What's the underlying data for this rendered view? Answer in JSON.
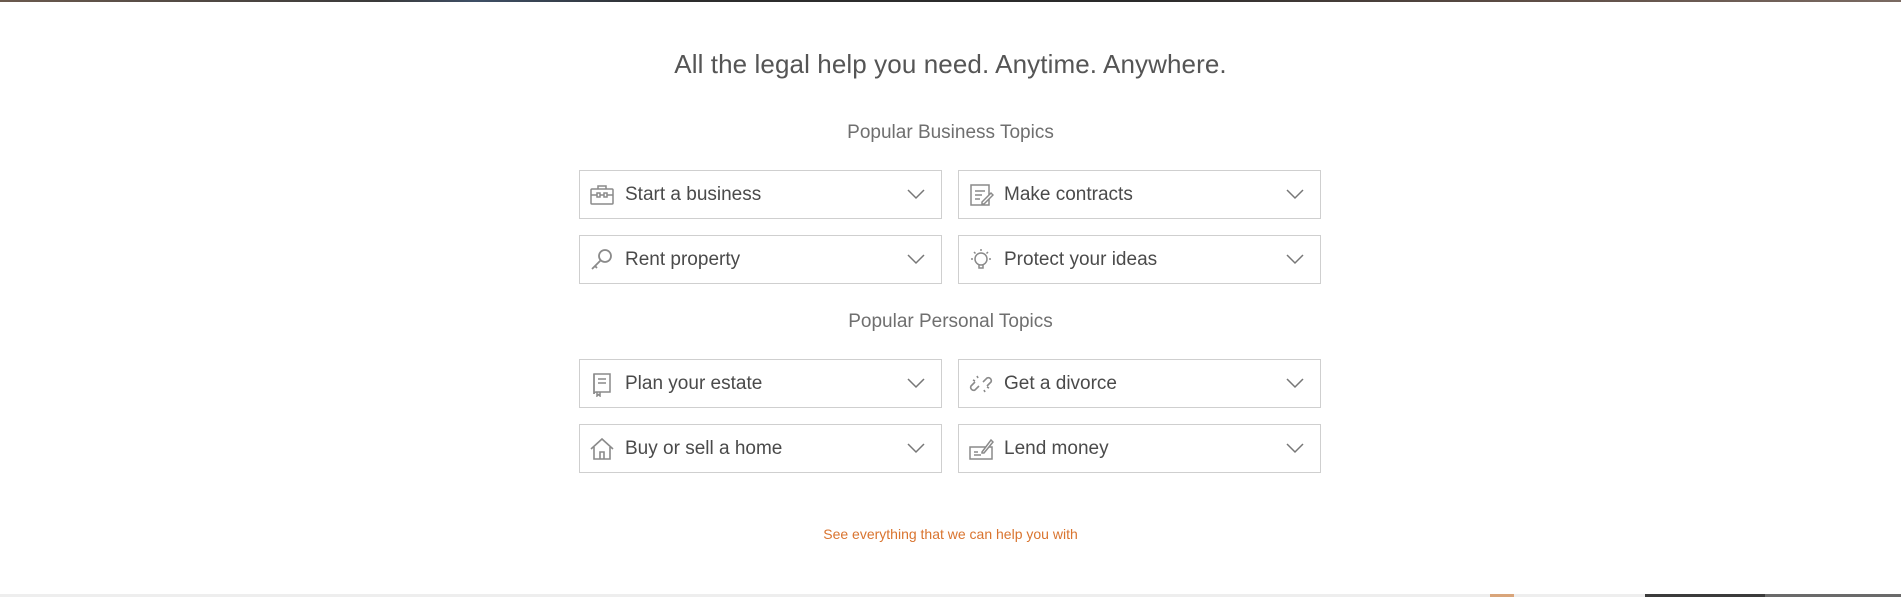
{
  "headline": "All the legal help you need. Anytime. Anywhere.",
  "business": {
    "title": "Popular Business Topics",
    "topics": [
      {
        "label": "Start a business",
        "icon": "briefcase-icon"
      },
      {
        "label": "Make contracts",
        "icon": "document-edit-icon"
      },
      {
        "label": "Rent property",
        "icon": "key-icon"
      },
      {
        "label": "Protect your ideas",
        "icon": "lightbulb-icon"
      }
    ]
  },
  "personal": {
    "title": "Popular Personal Topics",
    "topics": [
      {
        "label": "Plan your estate",
        "icon": "book-icon"
      },
      {
        "label": "Get a divorce",
        "icon": "broken-link-icon"
      },
      {
        "label": "Buy or sell a home",
        "icon": "house-icon"
      },
      {
        "label": "Lend money",
        "icon": "check-signing-icon"
      }
    ]
  },
  "see_all_link": "See everything that we can help you with",
  "colors": {
    "link": "#d9742f",
    "card_border": "#cfcfcf",
    "text": "#4a4a4a",
    "icon": "#8a8a8a"
  }
}
